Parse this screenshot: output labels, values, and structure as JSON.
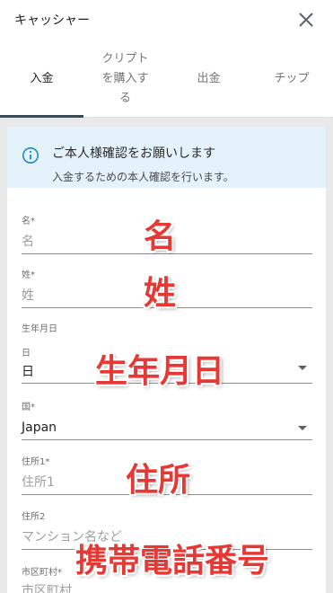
{
  "header": {
    "title": "キャッシャー"
  },
  "tabs": [
    {
      "label": "入金"
    },
    {
      "label": "クリプト\nを購入す\nる"
    },
    {
      "label": "出金"
    },
    {
      "label": "チップ"
    }
  ],
  "info": {
    "title": "ご本人様確認をお願いします",
    "subtitle": "入金するための本人確認を行います。"
  },
  "form": {
    "first_name": {
      "label": "名*",
      "placeholder": "名"
    },
    "last_name": {
      "label": "姓*",
      "placeholder": "姓"
    },
    "birthdate": {
      "label": "生年月日",
      "day_label": "日",
      "day_value": "日"
    },
    "country": {
      "label": "国*",
      "value": "Japan"
    },
    "address1": {
      "label": "住所1*",
      "placeholder": "住所1"
    },
    "address2": {
      "label": "住所2",
      "placeholder": "マンション名など"
    },
    "city": {
      "label": "市区町村*",
      "placeholder": "市区町村"
    }
  },
  "annotations": [
    "名",
    "姓",
    "生年月日",
    "住所",
    "携帯電話番号"
  ],
  "colors": {
    "annotation": "#e53935",
    "info_bg": "#e3f2fb",
    "info_icon": "#1e88c8",
    "tab_indicator": "#3c4a57"
  }
}
